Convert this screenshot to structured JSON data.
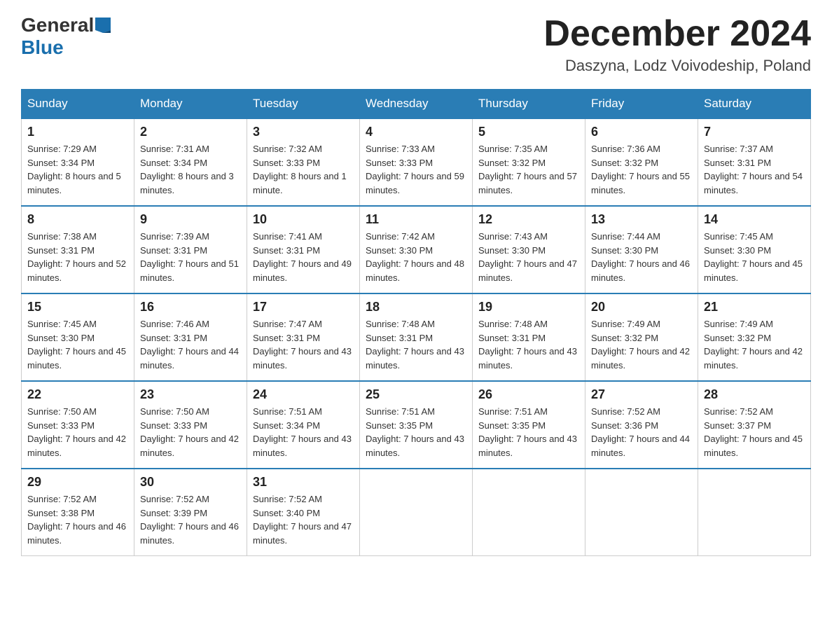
{
  "header": {
    "logo_general": "General",
    "logo_blue": "Blue",
    "month_title": "December 2024",
    "location": "Daszyna, Lodz Voivodeship, Poland"
  },
  "days_of_week": [
    "Sunday",
    "Monday",
    "Tuesday",
    "Wednesday",
    "Thursday",
    "Friday",
    "Saturday"
  ],
  "weeks": [
    [
      {
        "day": "1",
        "sunrise": "7:29 AM",
        "sunset": "3:34 PM",
        "daylight": "8 hours and 5 minutes."
      },
      {
        "day": "2",
        "sunrise": "7:31 AM",
        "sunset": "3:34 PM",
        "daylight": "8 hours and 3 minutes."
      },
      {
        "day": "3",
        "sunrise": "7:32 AM",
        "sunset": "3:33 PM",
        "daylight": "8 hours and 1 minute."
      },
      {
        "day": "4",
        "sunrise": "7:33 AM",
        "sunset": "3:33 PM",
        "daylight": "7 hours and 59 minutes."
      },
      {
        "day": "5",
        "sunrise": "7:35 AM",
        "sunset": "3:32 PM",
        "daylight": "7 hours and 57 minutes."
      },
      {
        "day": "6",
        "sunrise": "7:36 AM",
        "sunset": "3:32 PM",
        "daylight": "7 hours and 55 minutes."
      },
      {
        "day": "7",
        "sunrise": "7:37 AM",
        "sunset": "3:31 PM",
        "daylight": "7 hours and 54 minutes."
      }
    ],
    [
      {
        "day": "8",
        "sunrise": "7:38 AM",
        "sunset": "3:31 PM",
        "daylight": "7 hours and 52 minutes."
      },
      {
        "day": "9",
        "sunrise": "7:39 AM",
        "sunset": "3:31 PM",
        "daylight": "7 hours and 51 minutes."
      },
      {
        "day": "10",
        "sunrise": "7:41 AM",
        "sunset": "3:31 PM",
        "daylight": "7 hours and 49 minutes."
      },
      {
        "day": "11",
        "sunrise": "7:42 AM",
        "sunset": "3:30 PM",
        "daylight": "7 hours and 48 minutes."
      },
      {
        "day": "12",
        "sunrise": "7:43 AM",
        "sunset": "3:30 PM",
        "daylight": "7 hours and 47 minutes."
      },
      {
        "day": "13",
        "sunrise": "7:44 AM",
        "sunset": "3:30 PM",
        "daylight": "7 hours and 46 minutes."
      },
      {
        "day": "14",
        "sunrise": "7:45 AM",
        "sunset": "3:30 PM",
        "daylight": "7 hours and 45 minutes."
      }
    ],
    [
      {
        "day": "15",
        "sunrise": "7:45 AM",
        "sunset": "3:30 PM",
        "daylight": "7 hours and 45 minutes."
      },
      {
        "day": "16",
        "sunrise": "7:46 AM",
        "sunset": "3:31 PM",
        "daylight": "7 hours and 44 minutes."
      },
      {
        "day": "17",
        "sunrise": "7:47 AM",
        "sunset": "3:31 PM",
        "daylight": "7 hours and 43 minutes."
      },
      {
        "day": "18",
        "sunrise": "7:48 AM",
        "sunset": "3:31 PM",
        "daylight": "7 hours and 43 minutes."
      },
      {
        "day": "19",
        "sunrise": "7:48 AM",
        "sunset": "3:31 PM",
        "daylight": "7 hours and 43 minutes."
      },
      {
        "day": "20",
        "sunrise": "7:49 AM",
        "sunset": "3:32 PM",
        "daylight": "7 hours and 42 minutes."
      },
      {
        "day": "21",
        "sunrise": "7:49 AM",
        "sunset": "3:32 PM",
        "daylight": "7 hours and 42 minutes."
      }
    ],
    [
      {
        "day": "22",
        "sunrise": "7:50 AM",
        "sunset": "3:33 PM",
        "daylight": "7 hours and 42 minutes."
      },
      {
        "day": "23",
        "sunrise": "7:50 AM",
        "sunset": "3:33 PM",
        "daylight": "7 hours and 42 minutes."
      },
      {
        "day": "24",
        "sunrise": "7:51 AM",
        "sunset": "3:34 PM",
        "daylight": "7 hours and 43 minutes."
      },
      {
        "day": "25",
        "sunrise": "7:51 AM",
        "sunset": "3:35 PM",
        "daylight": "7 hours and 43 minutes."
      },
      {
        "day": "26",
        "sunrise": "7:51 AM",
        "sunset": "3:35 PM",
        "daylight": "7 hours and 43 minutes."
      },
      {
        "day": "27",
        "sunrise": "7:52 AM",
        "sunset": "3:36 PM",
        "daylight": "7 hours and 44 minutes."
      },
      {
        "day": "28",
        "sunrise": "7:52 AM",
        "sunset": "3:37 PM",
        "daylight": "7 hours and 45 minutes."
      }
    ],
    [
      {
        "day": "29",
        "sunrise": "7:52 AM",
        "sunset": "3:38 PM",
        "daylight": "7 hours and 46 minutes."
      },
      {
        "day": "30",
        "sunrise": "7:52 AM",
        "sunset": "3:39 PM",
        "daylight": "7 hours and 46 minutes."
      },
      {
        "day": "31",
        "sunrise": "7:52 AM",
        "sunset": "3:40 PM",
        "daylight": "7 hours and 47 minutes."
      },
      null,
      null,
      null,
      null
    ]
  ]
}
